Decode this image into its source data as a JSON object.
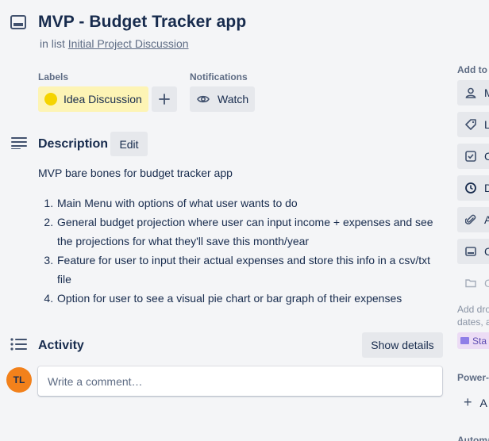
{
  "card": {
    "title": "MVP - Budget Tracker app",
    "in_list_prefix": "in list",
    "list_name": "Initial Project Discussion"
  },
  "labels": {
    "heading": "Labels",
    "items": [
      {
        "text": "Idea Discussion",
        "color": "#f5d400",
        "bg": "#fdf4b5"
      }
    ],
    "add_label": "+"
  },
  "notifications": {
    "heading": "Notifications",
    "watch_label": "Watch"
  },
  "description": {
    "heading": "Description",
    "edit_label": "Edit",
    "intro": "MVP bare bones for budget tracker app",
    "items": [
      "Main Menu with options of what user wants to do",
      "General budget projection where user can input income + expenses and see the projections for what they'll save this month/year",
      "Feature for user to input their actual expenses and store this info in a csv/txt file",
      "Option for user to see a visual pie chart or bar graph of their expenses"
    ]
  },
  "activity": {
    "heading": "Activity",
    "show_details": "Show details",
    "avatar_initials": "TL",
    "avatar_color": "#f2811b",
    "comment_placeholder": "Write a comment…"
  },
  "sidebar": {
    "add_to_heading": "Add to",
    "buttons": [
      {
        "icon": "person-icon",
        "label": "M"
      },
      {
        "icon": "tag-icon",
        "label": "La"
      },
      {
        "icon": "checklist-icon",
        "label": "C"
      },
      {
        "icon": "clock-icon",
        "label": "D"
      },
      {
        "icon": "paperclip-icon",
        "label": "A"
      },
      {
        "icon": "card-cover-icon",
        "label": "C"
      },
      {
        "icon": "folder-icon",
        "label": "C",
        "disabled": true
      }
    ],
    "note_line1": "Add dro",
    "note_line2": "dates, a",
    "start_badge": "Sta",
    "power_ups_heading": "Power-U",
    "power_ups_add": "A",
    "automation_heading": "Automa"
  }
}
